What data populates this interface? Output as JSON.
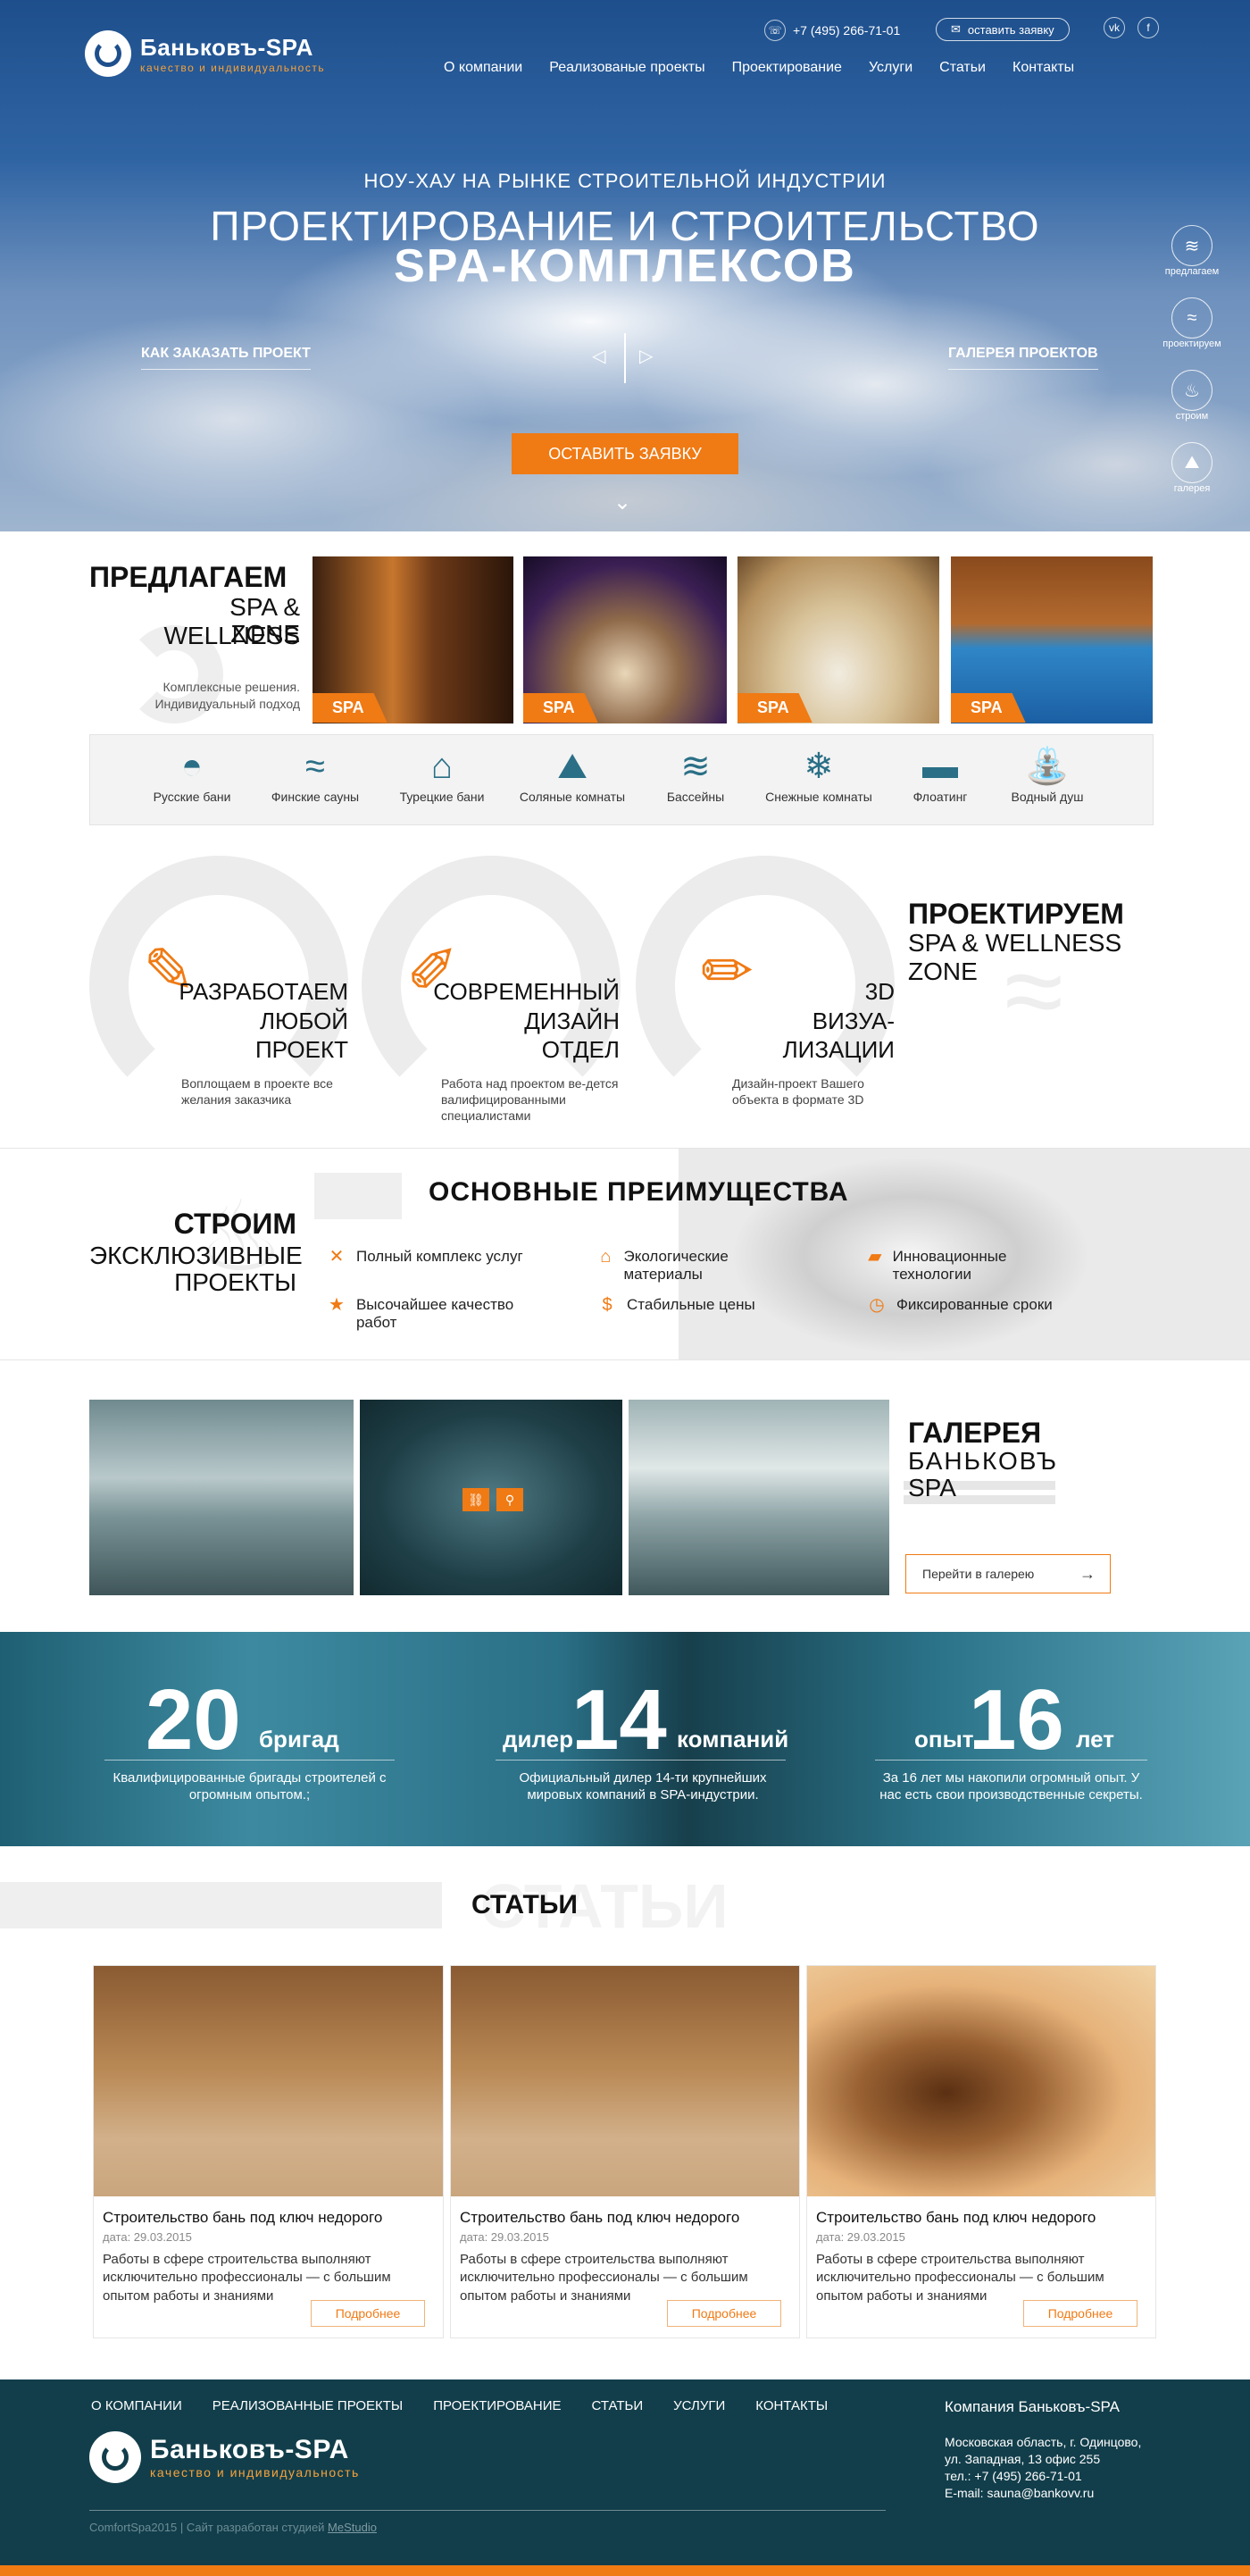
{
  "brand": {
    "name": "Баньковъ-SPA",
    "tagline": "качество и индивидуальность"
  },
  "topbar": {
    "phone": "+7 (495) 266-71-01",
    "request": "оставить заявку",
    "vk": "vk",
    "fb": "f"
  },
  "nav": [
    "О компании",
    "Реализованые проекты",
    "Проектирование",
    "Услуги",
    "Статьи",
    "Контакты"
  ],
  "hero": {
    "subtitle": "НОУ-ХАУ НА РЫНКЕ СТРОИТЕЛЬНОЙ ИНДУСТРИИ",
    "title1": "ПРОЕКТИРОВАНИЕ И СТРОИТЕЛЬСТВО",
    "title2": "SPA-КОМПЛЕКСОВ",
    "left_link": "КАК ЗАКАЗАТЬ ПРОЕКТ",
    "right_link": "ГАЛЕРЕЯ ПРОЕКТОВ",
    "cta": "ОСТАВИТЬ ЗАЯВКУ",
    "side": [
      {
        "icon": "waves-icon",
        "label": "предлагаем"
      },
      {
        "icon": "wind-icon",
        "label": "проектируем"
      },
      {
        "icon": "flame-icon",
        "label": "строим"
      },
      {
        "icon": "mountain-icon",
        "label": "галерея"
      }
    ]
  },
  "offer": {
    "h1": "ПРЕДЛАГАЕМ",
    "h2a": "SPA & WELLNESS",
    "h2b": "ZONE",
    "desc": "Комплексные решения. Индивидуальный подход",
    "tag": "SPA",
    "categories": [
      {
        "icon": "bowl-icon",
        "label": "Русские бани"
      },
      {
        "icon": "wind-icon",
        "label": "Финские сауны"
      },
      {
        "icon": "turkish-bath-icon",
        "label": "Турецкие бани"
      },
      {
        "icon": "mountain-icon",
        "label": "Соляные комнаты"
      },
      {
        "icon": "waves-icon",
        "label": "Бассейны"
      },
      {
        "icon": "snowflake-icon",
        "label": "Снежные комнаты"
      },
      {
        "icon": "floating-icon",
        "label": "Флоатинг"
      },
      {
        "icon": "shower-icon",
        "label": "Водный душ"
      }
    ]
  },
  "project": {
    "h1": "ПРОЕКТИРУЕМ",
    "h2a": "SPA & WELLNESS",
    "h2b": "ZONE",
    "features": [
      {
        "t1": "РАЗРАБОТАЕМ",
        "t2": "ЛЮБОЙ",
        "t3": "ПРОЕКТ",
        "p": "Воплощаем в проекте все желания заказчика"
      },
      {
        "t1": "СОВРЕМЕННЫЙ",
        "t2": "ДИЗАЙН",
        "t3": "ОТДЕЛ",
        "p": "Работа над проектом ве-дется валифицированными специалистами"
      },
      {
        "t1": "3D",
        "t2": "ВИЗУА-",
        "t3": "ЛИЗАЦИИ",
        "p": "Дизайн-проект Вашего объекта в формате 3D"
      }
    ]
  },
  "adv": {
    "left1": "СТРОИМ",
    "left2": "ЭКСКЛЮЗИВНЫЕ",
    "left3": "ПРОЕКТЫ",
    "title": "ОСНОВНЫЕ ПРЕИМУЩЕСТВА",
    "items": [
      {
        "icon": "tools-icon",
        "text": "Полный комплекс услуг"
      },
      {
        "icon": "eco-house-icon",
        "text": "Экологические материалы"
      },
      {
        "icon": "drill-icon",
        "text": "Инновационные технологии"
      },
      {
        "icon": "star-icon",
        "text": "Высочайшее качество работ"
      },
      {
        "icon": "dollar-icon",
        "text": "Стабильные цены"
      },
      {
        "icon": "clock-icon",
        "text": "Фиксированные сроки"
      }
    ]
  },
  "gallery": {
    "h1": "ГАЛЕРЕЯ",
    "h2": "БАНЬКОВЪ",
    "h3": "SPA",
    "btn": "Перейти в галерею"
  },
  "stats": [
    {
      "num": "20",
      "pre": "",
      "post": "бригад",
      "desc": "Квалифицированные бригады строителей с огромным опытом.;"
    },
    {
      "num": "14",
      "pre": "дилер",
      "post": "компаний",
      "desc": "Официальный дилер 14-ти крупнейших мировых компаний в SPA-индустрии."
    },
    {
      "num": "16",
      "pre": "опыт",
      "post": "лет",
      "desc": "За 16 лет мы накопили огромный опыт. У нас есть свои производственные секреты."
    }
  ],
  "articles": {
    "title": "СТАТЬИ",
    "ghost": "СТАТЬИ",
    "more": "Подробнее",
    "items": [
      {
        "title": "Строительство бань под ключ недорого",
        "date": "дата: 29.03.2015",
        "text": "Работы в сфере строительства выполняют исключительно профессионалы — с большим опытом работы и знаниями"
      },
      {
        "title": "Строительство бань под ключ недорого",
        "date": "дата: 29.03.2015",
        "text": "Работы в сфере строительства выполняют исключительно профессионалы — с большим опытом работы и знаниями"
      },
      {
        "title": "Строительство бань под ключ недорого",
        "date": "дата: 29.03.2015",
        "text": "Работы в сфере строительства выполняют исключительно профессионалы — с большим опытом работы и знаниями"
      }
    ]
  },
  "footer": {
    "nav": [
      "О КОМПАНИИ",
      "РЕАЛИЗОВАННЫЕ ПРОЕКТЫ",
      "ПРОЕКТИРОВАНИЕ",
      "СТАТЬИ",
      "УСЛУГИ",
      "КОНТАКТЫ"
    ],
    "company": "Компания Баньковъ-SPA",
    "addr1": "Московская область, г. Одинцово,",
    "addr2": "ул. Западная, 13 офис 255",
    "tel": "тел.: +7 (495) 266-71-01",
    "email": "E-mail: sauna@bankovv.ru",
    "copy": "ComfortSpa2015 | Сайт разработан студией ",
    "studio": "MeStudio"
  },
  "colors": {
    "accent": "#f07a14",
    "teal": "#2a6f86",
    "footer": "#123e4b"
  }
}
